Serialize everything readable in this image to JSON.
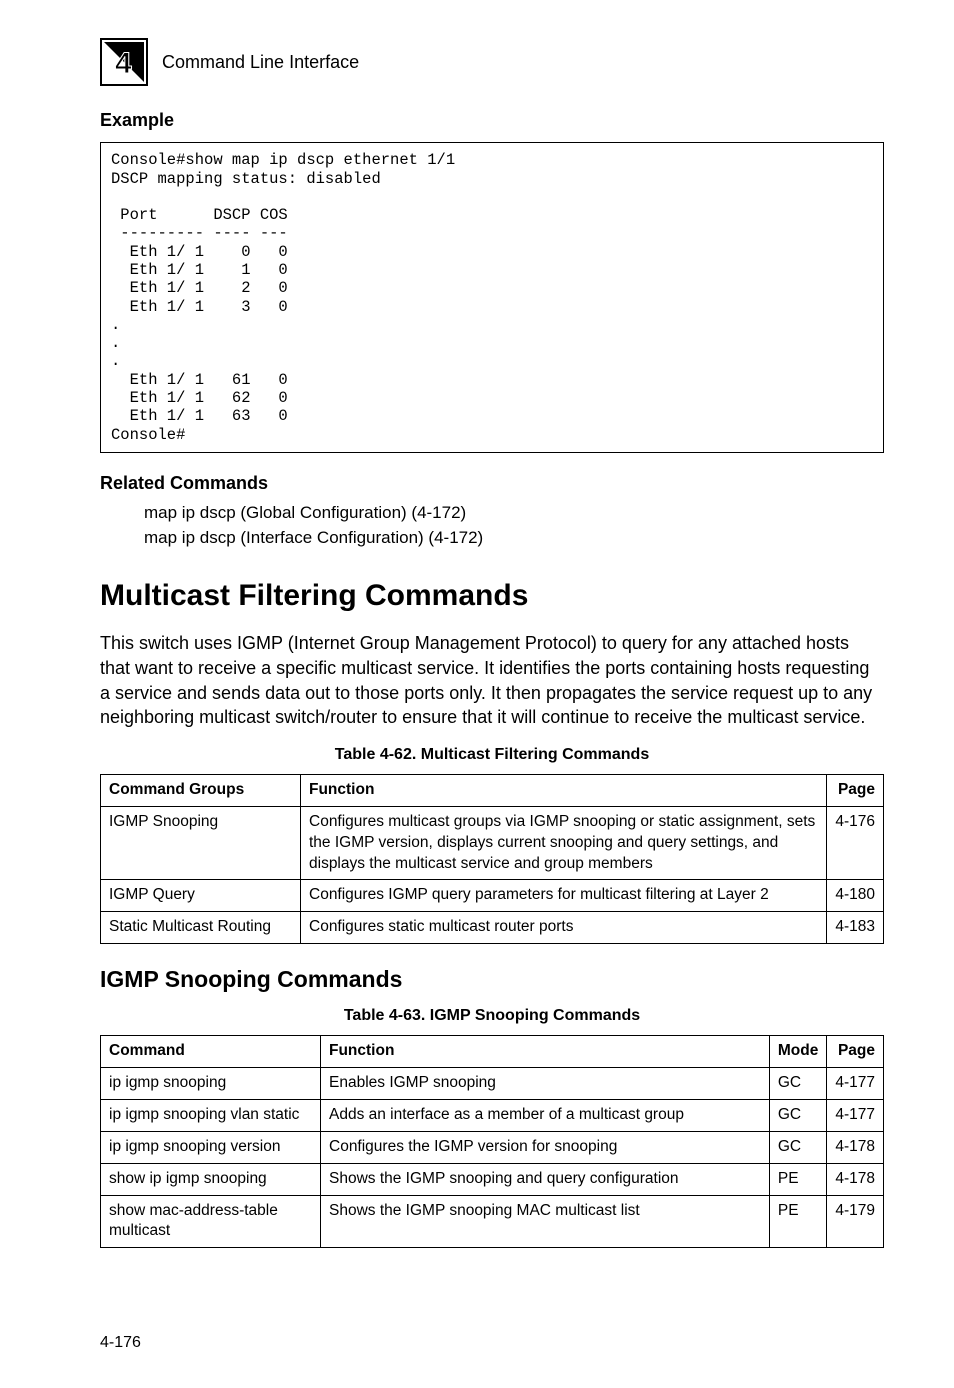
{
  "chapter": {
    "number_svg_label": "4",
    "label": "Command Line Interface"
  },
  "example": {
    "heading": "Example",
    "code": "Console#show map ip dscp ethernet 1/1\nDSCP mapping status: disabled\n\n Port      DSCP COS\n --------- ---- ---\n  Eth 1/ 1    0   0\n  Eth 1/ 1    1   0\n  Eth 1/ 1    2   0\n  Eth 1/ 1    3   0\n.\n.\n.\n  Eth 1/ 1   61   0\n  Eth 1/ 1   62   0\n  Eth 1/ 1   63   0\nConsole#"
  },
  "related": {
    "heading": "Related Commands",
    "line1": "map ip dscp (Global Configuration) (4-172)",
    "line2": "map ip dscp (Interface Configuration) (4-172)"
  },
  "section": {
    "title": "Multicast Filtering Commands",
    "body": "This switch uses IGMP (Internet Group Management Protocol) to query for any attached hosts that want to receive a specific multicast service. It identifies the ports containing hosts requesting a service and sends data out to those ports only. It then propagates the service request up to any neighboring multicast switch/router to ensure that it will continue to receive the multicast service."
  },
  "table62": {
    "caption": "Table 4-62.   Multicast Filtering Commands",
    "headers": {
      "c1": "Command Groups",
      "c2": "Function",
      "c3": "Page"
    },
    "rows": [
      {
        "c1": "IGMP Snooping",
        "c2": "Configures multicast groups via IGMP snooping or static assignment, sets the IGMP version, displays current snooping and query settings, and displays the multicast service and group members",
        "c3": "4-176"
      },
      {
        "c1": "IGMP Query",
        "c2": "Configures IGMP query parameters for multicast filtering at Layer 2",
        "c3": "4-180"
      },
      {
        "c1": "Static Multicast Routing",
        "c2": "Configures static multicast router ports",
        "c3": "4-183"
      }
    ]
  },
  "subsection": {
    "title": "IGMP Snooping Commands"
  },
  "table63": {
    "caption": "Table 4-63.   IGMP Snooping Commands",
    "headers": {
      "c1": "Command",
      "c2": "Function",
      "c3": "Mode",
      "c4": "Page"
    },
    "rows": [
      {
        "c1": "ip igmp snooping",
        "c2": "Enables IGMP snooping",
        "c3": "GC",
        "c4": "4-177"
      },
      {
        "c1": "ip igmp snooping vlan static",
        "c2": "Adds an interface as a member of a multicast group",
        "c3": "GC",
        "c4": "4-177"
      },
      {
        "c1": "ip igmp snooping version",
        "c2": "Configures the IGMP version for snooping",
        "c3": "GC",
        "c4": "4-178"
      },
      {
        "c1": "show ip igmp snooping",
        "c2": "Shows the IGMP snooping and query configuration",
        "c3": "PE",
        "c4": "4-178"
      },
      {
        "c1": "show mac-address-table multicast",
        "c2": "Shows the IGMP snooping MAC multicast list",
        "c3": "PE",
        "c4": "4-179"
      }
    ]
  },
  "page_number": "4-176"
}
